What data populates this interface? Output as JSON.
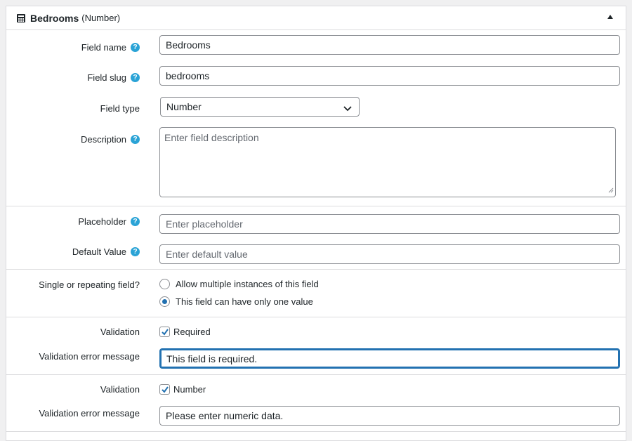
{
  "header": {
    "title": "Bedrooms",
    "subtitle": "(Number)",
    "icon": "calculator-icon",
    "collapse_icon": "triangle-up-icon"
  },
  "fields": {
    "field_name": {
      "label": "Field name",
      "value": "Bedrooms",
      "help": "?"
    },
    "field_slug": {
      "label": "Field slug",
      "value": "bedrooms",
      "help": "?"
    },
    "field_type": {
      "label": "Field type",
      "value": "Number"
    },
    "description": {
      "label": "Description",
      "placeholder": "Enter field description",
      "help": "?"
    },
    "placeholder": {
      "label": "Placeholder",
      "placeholder": "Enter placeholder",
      "help": "?"
    },
    "default_value": {
      "label": "Default Value",
      "placeholder": "Enter default value",
      "help": "?"
    }
  },
  "repeating": {
    "label": "Single or repeating field?",
    "options": [
      {
        "label": "Allow multiple instances of this field",
        "checked": false
      },
      {
        "label": "This field can have only one value",
        "checked": true
      }
    ]
  },
  "validation_required": {
    "label": "Validation",
    "checkbox_label": "Required",
    "error_label": "Validation error message",
    "error_value": "This field is required."
  },
  "validation_number": {
    "label": "Validation",
    "checkbox_label": "Number",
    "error_label": "Validation error message",
    "error_value": "Please enter numeric data."
  },
  "colors": {
    "accent": "#2271b1",
    "help_badge": "#2aa3d6",
    "border": "#dcdcde"
  }
}
